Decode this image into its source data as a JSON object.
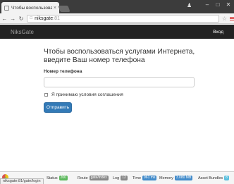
{
  "browser": {
    "tab_title": "Чтобы воспользоваться",
    "tab_close": "×",
    "address_host": "niksgate",
    "address_port": ":81",
    "icons": {
      "back": "back-arrow-icon",
      "forward": "forward-arrow-icon",
      "reload": "reload-icon",
      "page": "page-info-icon",
      "bookmark": "star-icon",
      "menu": "menu-icon",
      "user": "user-icon",
      "minimize": "minimize-icon",
      "maximize": "maximize-icon",
      "close": "close-icon"
    },
    "status_url": "niksgate:81/gate/login"
  },
  "navbar": {
    "brand": "NiksGate",
    "login": "Вход"
  },
  "form": {
    "heading": "Чтобы воспользоваться услугами Интернета, введите Ваш номер телефона",
    "phone_label": "Номер телефона",
    "phone_value": "",
    "agree_label": "Я принимаю условия соглашения",
    "submit": "Отправить"
  },
  "debug": {
    "status_label": "Status",
    "status_value": "200",
    "route_label": "Route",
    "route_value": "gate/index",
    "log_label": "Log",
    "log_value": "12",
    "time_label": "Time",
    "time_value": "961 ms",
    "memory_label": "Memory",
    "memory_value": "3.080 MB",
    "bundles_label": "Asset Bundles",
    "bundles_value": "8"
  },
  "colors": {
    "navbar_bg": "#222222",
    "primary": "#337ab7",
    "status_green": "#5cb85c",
    "status_blue": "#428bca"
  }
}
